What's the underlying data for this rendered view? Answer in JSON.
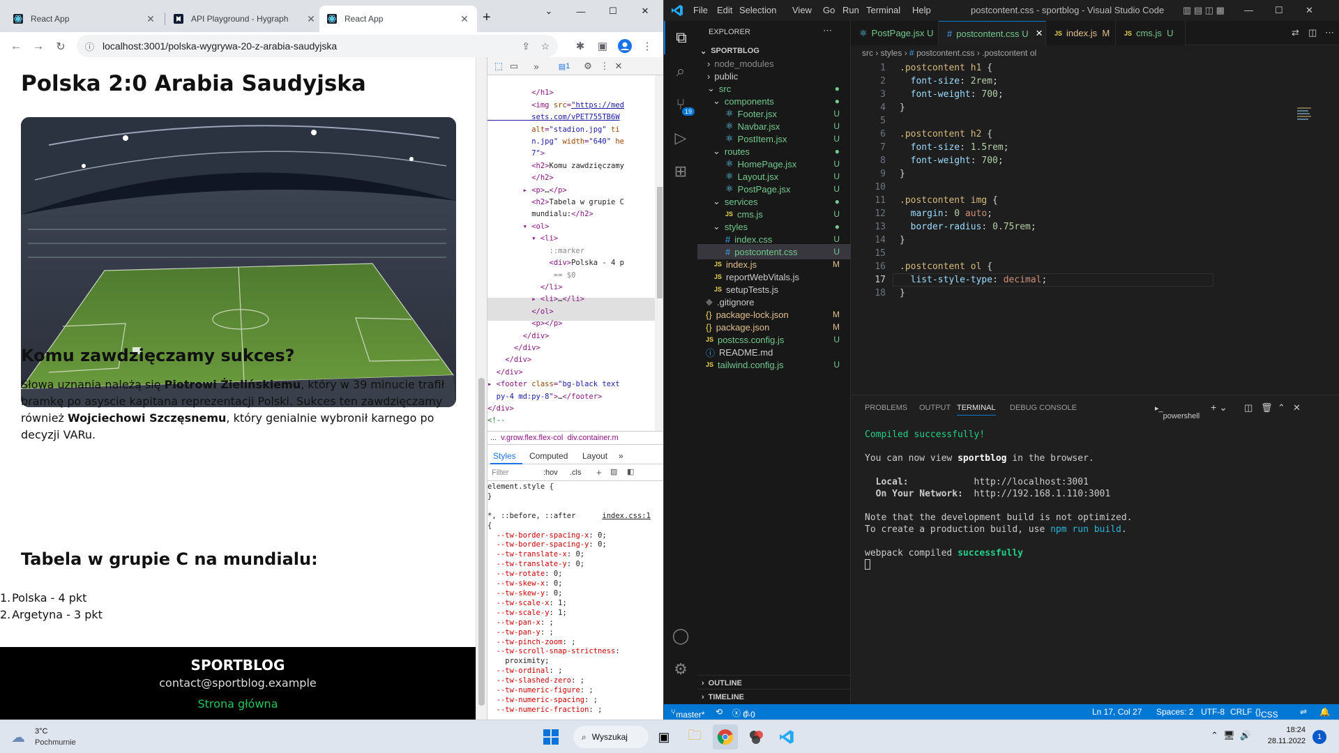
{
  "chrome": {
    "tabs": [
      {
        "title": "React App",
        "active": false
      },
      {
        "title": "API Playground - Hygraph",
        "active": false
      },
      {
        "title": "React App",
        "active": true
      }
    ],
    "url": "localhost:3001/polska-wygrywa-20-z-arabia-saudyjska",
    "page": {
      "title": "Polska 2:0 Arabia Saudyjska",
      "h2_1": "Komu zawdzięczamy sukces?",
      "p1_a": "Słowa uznania należą się ",
      "p1_b": "Piotrowi Żielińskiemu",
      "p1_c": ", który w 39 minucie trafił bramkę po asyscie kapitana reprezentacji Polski. Sukces ten zawdzięczamy również ",
      "p1_d": "Wojciechowi Szczęsnemu",
      "p1_e": ", który genialnie wybronił karnego po decyzji VARu.",
      "h2_2": "Tabela w grupie C na mundialu:",
      "list": [
        "Polska - 4 pkt",
        "Argetyna - 3 pkt"
      ],
      "footer_brand": "SPORTBLOG",
      "footer_email": "contact@sportblog.example",
      "footer_link": "Strona główna"
    },
    "devtools": {
      "issues_count": "1",
      "crumb_1": "...",
      "crumb_2": "v.grow.flex.flex-col",
      "crumb_3": "div.container.m",
      "style_tabs": [
        "Styles",
        "Computed",
        "Layout",
        "»"
      ],
      "filter_placeholder": "Filter",
      "hov": ":hov",
      "cls": ".cls",
      "element_style": "element.style {",
      "close_brace": "}",
      "rule_selector": "*, ::before, ::after",
      "rule_source": "index.css:1",
      "rule_open": "{"
    }
  },
  "vscode": {
    "title": "postcontent.css - sportblog - Visual Studio Code",
    "menu": [
      "File",
      "Edit",
      "Selection",
      "View",
      "Go",
      "Run",
      "Terminal",
      "Help"
    ],
    "explorer_title": "EXPLORER",
    "project": "SPORTBLOG",
    "tabs": [
      {
        "name": "PostPage.jsx",
        "status": "U"
      },
      {
        "name": "postcontent.css",
        "status": "U"
      },
      {
        "name": "index.js",
        "status": "M"
      },
      {
        "name": "cms.js",
        "status": "U"
      }
    ],
    "breadcrumb": [
      "src",
      "styles",
      "postcontent.css",
      ".postcontent ol"
    ],
    "outline": "OUTLINE",
    "timeline": "TIMELINE",
    "panel_tabs": [
      "PROBLEMS",
      "OUTPUT",
      "TERMINAL",
      "DEBUG CONSOLE"
    ],
    "shell": "powershell",
    "terminal": {
      "l1": "Compiled successfully!",
      "l2a": "You can now view ",
      "l2b": "sportblog",
      "l2c": " in the browser.",
      "l3a": "  Local:",
      "l3b": "http://localhost:3001",
      "l4a": "  On Your Network:",
      "l4b": "http://192.168.1.110:3001",
      "l5": "Note that the development build is not optimized.",
      "l6a": "To create a production build, use ",
      "l6b": "npm run build",
      "l6c": ".",
      "l7a": "webpack compiled ",
      "l7b": "successfully"
    },
    "status": {
      "branch": "master*",
      "errors": "0",
      "warnings": "0",
      "position": "Ln 17, Col 27",
      "spaces": "Spaces: 2",
      "encoding": "UTF-8",
      "eol": "CRLF",
      "lang": "CSS"
    },
    "source_control_badge": "19"
  },
  "taskbar": {
    "weather_temp": "3°C",
    "weather_desc": "Pochmurnie",
    "search": "Wyszukaj",
    "time": "18:24",
    "date": "28.11.2022",
    "notif": "1"
  },
  "colors": {
    "vscode_accent": "#0078d4",
    "git_untracked": "#73c991",
    "git_modified": "#e2c08d",
    "footer_link": "#22c55e"
  }
}
